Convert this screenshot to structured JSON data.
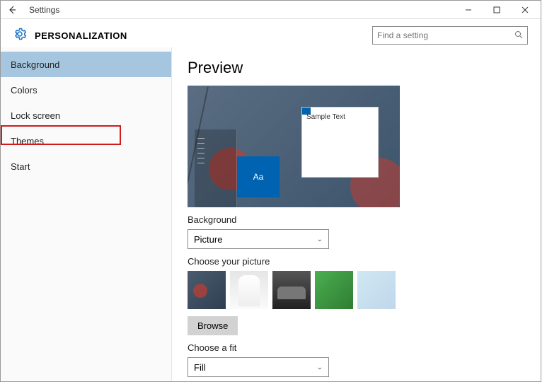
{
  "titlebar": {
    "title": "Settings"
  },
  "header": {
    "title": "PERSONALIZATION"
  },
  "search": {
    "placeholder": "Find a setting"
  },
  "sidebar": {
    "items": [
      {
        "label": "Background"
      },
      {
        "label": "Colors"
      },
      {
        "label": "Lock screen"
      },
      {
        "label": "Themes"
      },
      {
        "label": "Start"
      }
    ]
  },
  "content": {
    "preview_title": "Preview",
    "sample_text": "Sample Text",
    "tile_text": "Aa",
    "background_label": "Background",
    "background_value": "Picture",
    "choose_picture_label": "Choose your picture",
    "browse_label": "Browse",
    "choose_fit_label": "Choose a fit",
    "fit_value": "Fill"
  }
}
